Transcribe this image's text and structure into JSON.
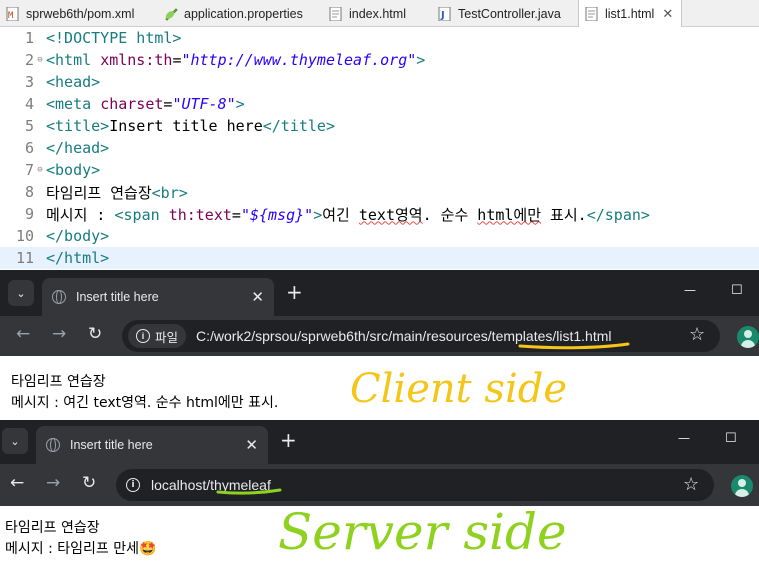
{
  "editor": {
    "tabs": [
      {
        "label": "sprweb6th/pom.xml",
        "icon": "xml-file-icon",
        "active": false
      },
      {
        "label": "application.properties",
        "icon": "properties-file-icon",
        "active": false
      },
      {
        "label": "index.html",
        "icon": "html-file-icon",
        "active": false
      },
      {
        "label": "TestController.java",
        "icon": "java-file-icon",
        "active": false
      },
      {
        "label": "list1.html",
        "icon": "html-file-icon",
        "active": true
      }
    ],
    "tab_close": "✕",
    "lines": [
      {
        "n": "1",
        "fold": false,
        "seg": [
          "<!DOCTYPE html>"
        ]
      },
      {
        "n": "2",
        "fold": true,
        "seg": [
          "<html ",
          "xmlns:th",
          "=",
          "\"http://www.thymeleaf.org\"",
          ">"
        ]
      },
      {
        "n": "3",
        "fold": false,
        "seg": [
          "<head>"
        ]
      },
      {
        "n": "4",
        "fold": false,
        "seg": [
          "<meta ",
          "charset",
          "=",
          "\"UTF-8\"",
          ">"
        ]
      },
      {
        "n": "5",
        "fold": false,
        "seg": [
          "<title>",
          "Insert title here",
          "</title>"
        ]
      },
      {
        "n": "6",
        "fold": false,
        "seg": [
          "</head>"
        ]
      },
      {
        "n": "7",
        "fold": true,
        "seg": [
          "<body>"
        ]
      },
      {
        "n": "8",
        "fold": false,
        "seg": [
          "타임리프 연습장",
          "<br>"
        ]
      },
      {
        "n": "9",
        "fold": false,
        "seg": [
          "메시지 : ",
          "<span ",
          "th:text",
          "=",
          "\"${msg}\"",
          ">",
          "여긴 ",
          "text영역",
          ". 순수 ",
          "html에만",
          " 표시.",
          "</span>"
        ]
      },
      {
        "n": "10",
        "fold": false,
        "seg": [
          "</body>"
        ]
      },
      {
        "n": "11",
        "fold": false,
        "seg": [
          "</html>"
        ]
      }
    ]
  },
  "client_browser": {
    "tab_title": "Insert title here",
    "file_chip": "파일",
    "url": "C:/work2/sprsou/sprweb6th/src/main/resources/templates/list1.html",
    "body_line1": "타임리프 연습장",
    "body_line2": "메시지 : 여긴 text영역. 순수 html에만 표시.",
    "annotation": "Client side",
    "annotation_color": "#f5c518"
  },
  "server_browser": {
    "tab_title": "Insert title here",
    "url": "localhost/thymeleaf",
    "body_line1": "타임리프 연습장",
    "body_line2": "메시지 : 타임리프 만세",
    "emoji": "🤩",
    "annotation": "Server side",
    "annotation_color": "#8ed11e"
  },
  "chrome_controls": {
    "tab_search": "⌄",
    "new_tab": "+",
    "minimize": "—",
    "maximize": "☐",
    "back": "←",
    "forward": "→",
    "reload": "↻",
    "bookmark": "☆"
  },
  "colors": {
    "tag": "#177c80",
    "attr": "#7f0055",
    "string": "#2a00ff",
    "chrome_frame": "#202124",
    "chrome_toolbar": "#35363a"
  }
}
